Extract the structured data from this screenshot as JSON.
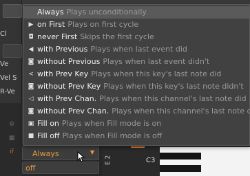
{
  "background": {
    "left_labels": [
      "Cl",
      "Ve",
      "Vel S",
      "R-Ve"
    ],
    "trigger_dropdown": {
      "value": "Always"
    },
    "fill_field": {
      "value": "off"
    },
    "piano": {
      "key_label": "C3",
      "lane_label": "E 2"
    }
  },
  "menu": {
    "items": [
      {
        "label": "Always",
        "desc": "Plays unconditionally",
        "icon": "none",
        "selected": true
      },
      {
        "label": "on First",
        "desc": "Plays on first cycle",
        "icon": "play-triangle-icon"
      },
      {
        "label": "never First",
        "desc": "Skips the first cycle",
        "icon": "skip-first-icon"
      },
      {
        "label": "with Previous",
        "desc": "Plays when last event did",
        "icon": "previous-icon"
      },
      {
        "label": "without Previous",
        "desc": "Plays when last event didn't",
        "icon": "no-previous-icon"
      },
      {
        "label": "with Prev Key",
        "desc": "Plays when this key's last note did",
        "icon": "prev-key-icon"
      },
      {
        "label": "without Prev Key",
        "desc": "Plays when this key's last note didn't",
        "icon": "no-prev-key-icon"
      },
      {
        "label": "with Prev Chan.",
        "desc": "Plays when this channel's last note did",
        "icon": "prev-channel-icon"
      },
      {
        "label": "without Prev Chan.",
        "desc": "Plays when this channel's last note didn't",
        "icon": "no-prev-channel-icon"
      },
      {
        "label": "Fill on",
        "desc": "Plays when Fill mode is on",
        "icon": "fill-on-icon"
      },
      {
        "label": "Fill off",
        "desc": "Plays when Fill mode is off",
        "icon": "fill-off-icon"
      }
    ]
  },
  "colors": {
    "accent": "#e89a3c",
    "menu_bg": "#414141",
    "selected_bg": "#5a5a5a",
    "desc_text": "#9a9a9a"
  }
}
